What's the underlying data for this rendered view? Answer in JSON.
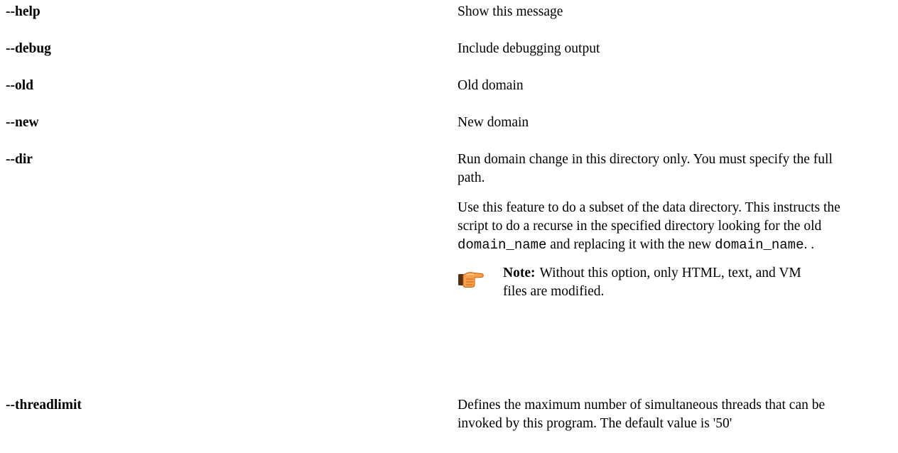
{
  "options": [
    {
      "name": "--help",
      "description": "Show this message"
    },
    {
      "name": "--debug",
      "description": "Include debugging output"
    },
    {
      "name": "--old",
      "description": "Old domain"
    },
    {
      "name": "--new",
      "description": "New domain"
    },
    {
      "name": "--dir",
      "description": "Run domain change in this directory only. You must specify the full path.",
      "detail": {
        "text_1": "Use this feature to do a subset of the data directory. This instructs the script to do a recurse in the specified directory looking for the old ",
        "code_1": "domain_name",
        "text_2": " and replacing it with the new ",
        "code_2": "domain_name",
        "text_3": ". ."
      },
      "note": {
        "icon": "pointing-hand-icon",
        "label": "Note:",
        "text": "Without this option, only HTML, text, and VM files are modified."
      }
    },
    {
      "name": "--threadlimit",
      "description": "Defines the maximum number of simultaneous threads that can be invoked by this program. The default value is '50'"
    }
  ]
}
